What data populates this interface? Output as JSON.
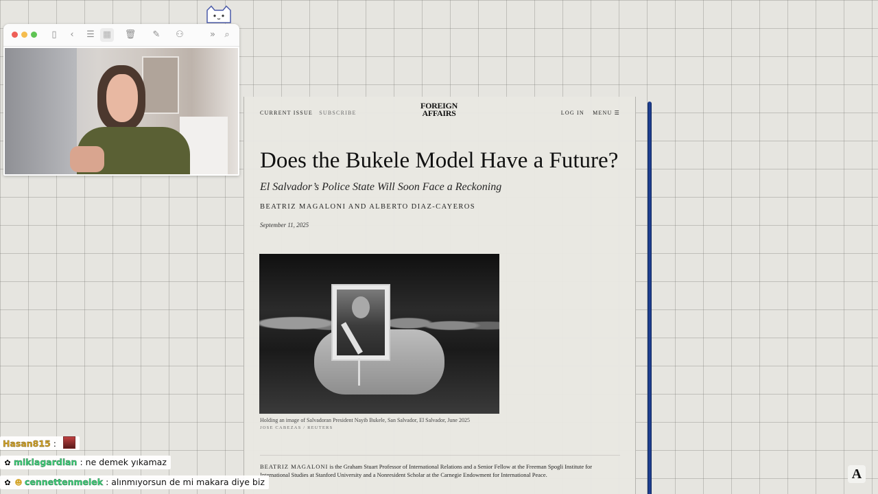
{
  "toolbar": {
    "icons": [
      "sidebar-icon",
      "back-icon",
      "list-icon",
      "grid-icon",
      "trash-icon",
      "compose-icon",
      "share-icon",
      "more-icon",
      "search-icon"
    ]
  },
  "article": {
    "nav": {
      "current_issue": "CURRENT ISSUE",
      "subscribe": "SUBSCRIBE",
      "logo_line1": "FOREIGN",
      "logo_line2": "AFFAIRS",
      "login": "LOG IN",
      "menu": "MENU"
    },
    "headline": "Does the Bukele Model Have a Future?",
    "dek": "El Salvador’s Police State Will Soon Face a Reckoning",
    "byline": "BEATRIZ MAGALONI AND ALBERTO DIAZ-CAYEROS",
    "date": "September 11, 2025",
    "caption": "Holding an image of Salvadoran President Nayib Bukele, San Salvador, El Salvador, June 2025",
    "credit": "JOSE CABEZAS / REUTERS",
    "bio_name": "BEATRIZ MAGALONI",
    "bio_text": " is the Graham Stuart Professor of International Relations and a Senior Fellow at the Freeman Spogli Institute for International Studies at Stanford University and a Nonresident Scholar at the Carnegie Endowment for International Peace."
  },
  "corner_logo": "A",
  "chat": [
    {
      "user": "Hasan815",
      "separator": ":",
      "message": "",
      "emote": true
    },
    {
      "user": "miklagardian",
      "separator": ":",
      "message": "ne demek yıkamaz",
      "emote": false
    },
    {
      "user": "cennettenmelek",
      "separator": ":",
      "message": "alınmıyorsun de mi makara diye biz",
      "emote": false
    }
  ],
  "colors": {
    "gold_user": "#d4a52a",
    "green_user": "#3fcf7a",
    "scrollbar_blue": "#2244a0"
  }
}
